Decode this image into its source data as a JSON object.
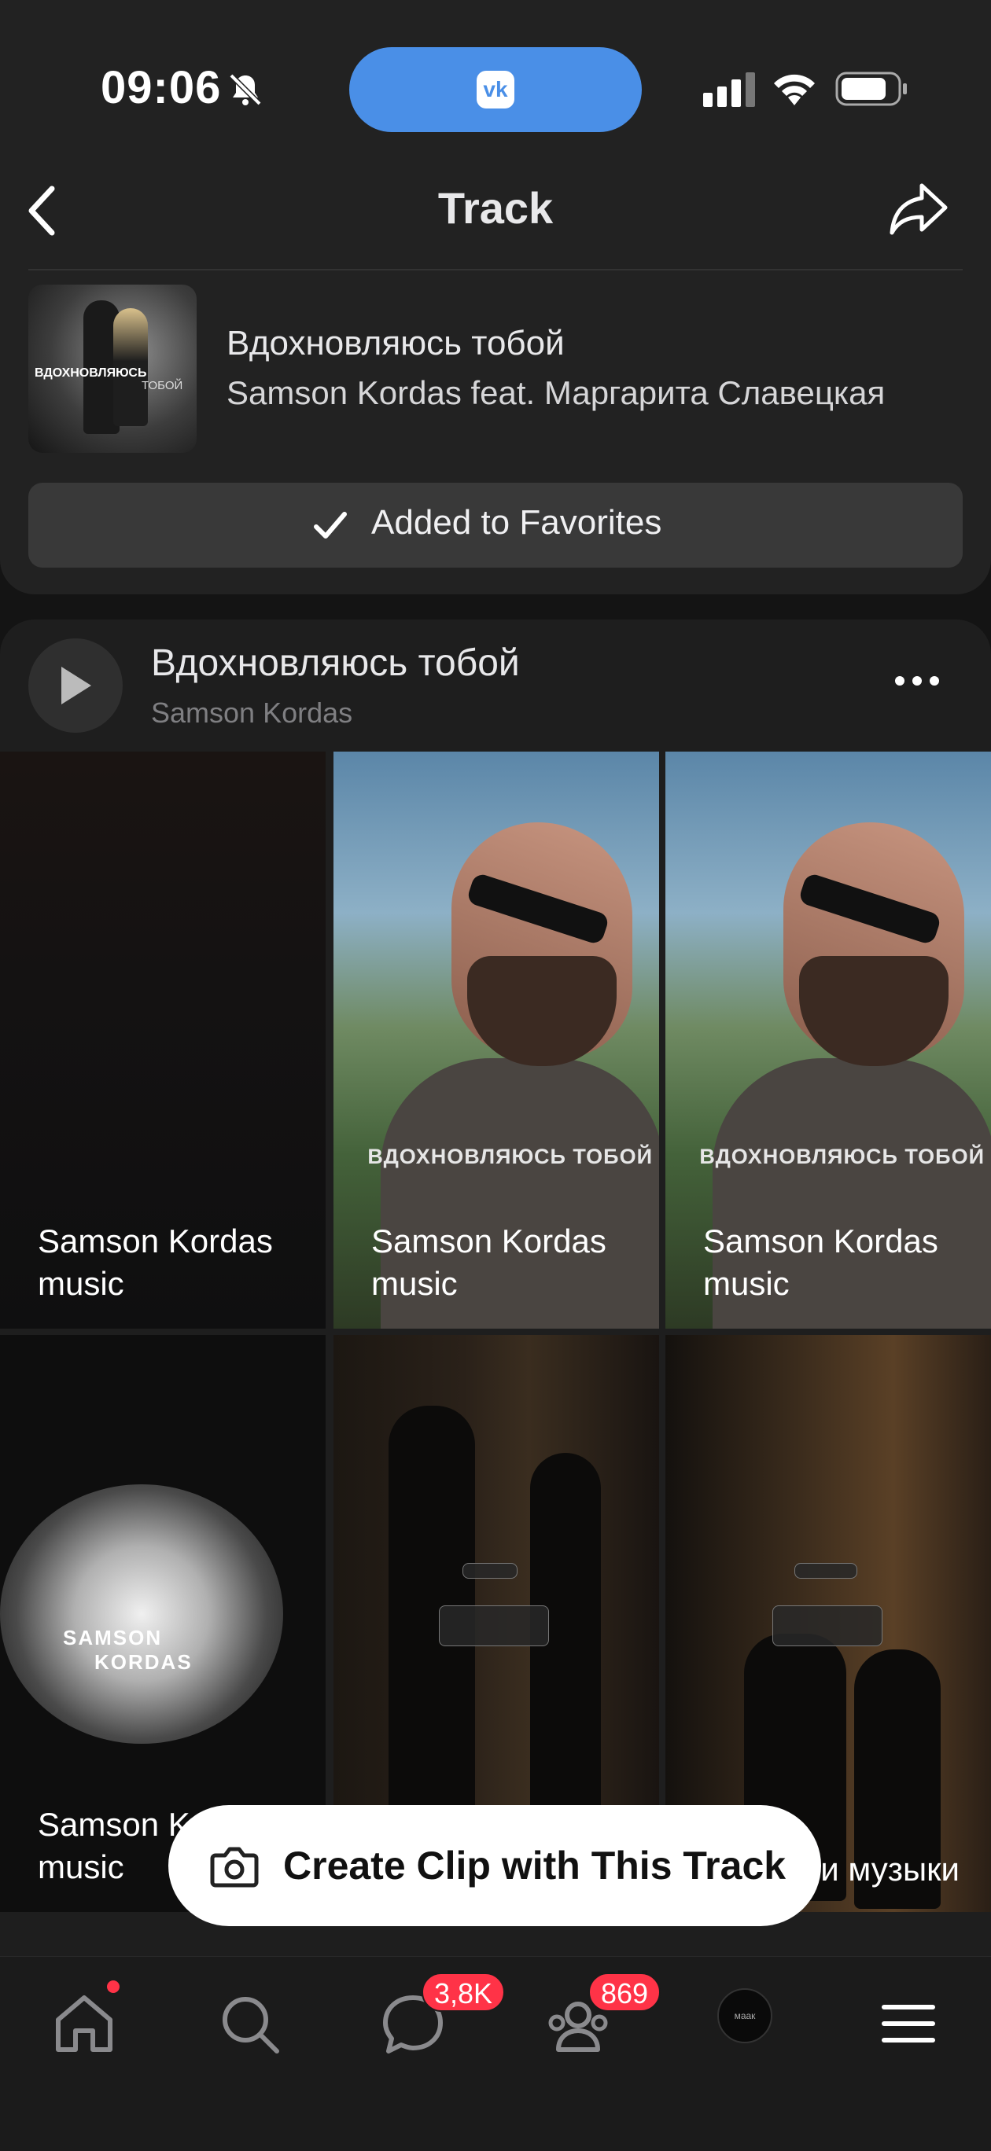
{
  "status_bar": {
    "time": "09:06"
  },
  "header": {
    "title": "Track"
  },
  "track": {
    "title": "Вдохновляюсь тобой",
    "artist": "Samson Kordas feat. Маргарита Славецкая",
    "cover_text_1": "ВДОХНОВЛЯЮСЬ",
    "cover_text_2": "ТОБОЙ",
    "favorite_label": "Added to Favorites"
  },
  "player_row": {
    "title": "Вдохновляюсь тобой",
    "artist": "Samson Kordas"
  },
  "clips": [
    {
      "label": "Samson Kordas music"
    },
    {
      "label": "Samson Kordas music",
      "overlay": "ВДОХНОВЛЯЮСЬ ТОБОЙ"
    },
    {
      "label": "Samson Kordas music",
      "overlay": "ВДОХНОВЛЯЮСЬ ТОБОЙ"
    },
    {
      "label": "Samson Kordas music",
      "overlay_1": "SAMSON",
      "overlay_2": "KORDAS"
    },
    {
      "label": ""
    },
    {
      "label": "и музыки"
    }
  ],
  "create_clip": {
    "label": "Create Clip with This Track"
  },
  "tabbar": {
    "messages_badge": "3,8K",
    "friends_badge": "869",
    "avatar_text": "маак"
  },
  "colors": {
    "accent_blue": "#4a8fe7",
    "badge_red": "#ff3347",
    "background": "#141414"
  }
}
